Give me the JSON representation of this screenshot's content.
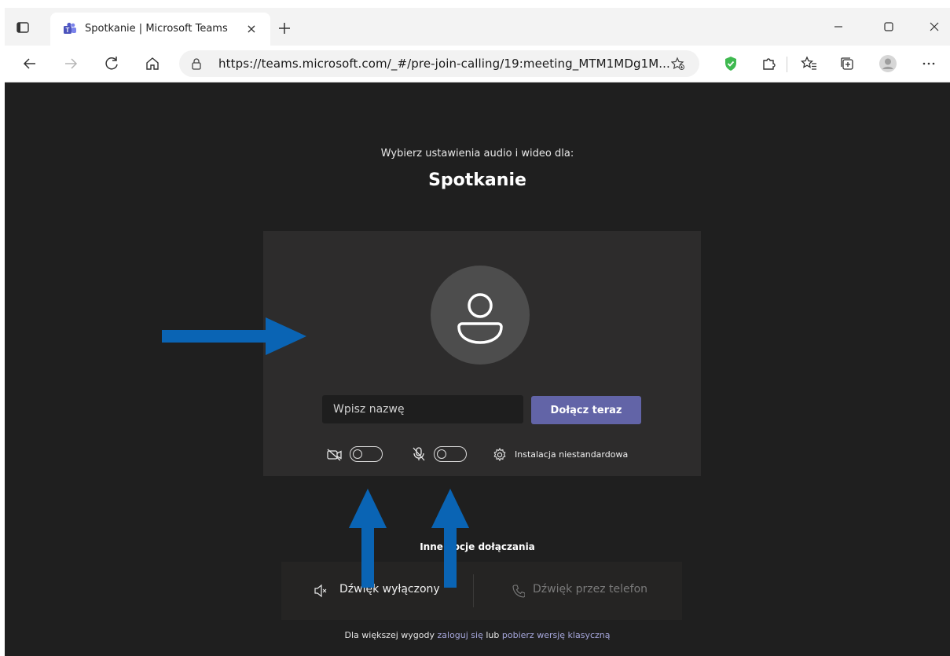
{
  "browser": {
    "tab_title": "Spotkanie | Microsoft Teams",
    "tab_close": "×",
    "url": "https://teams.microsoft.com/_#/pre-join-calling/19:meeting_MTM1MDg1M...",
    "window_controls": [
      "minimize-icon",
      "maximize-icon",
      "close-icon"
    ],
    "toolbar_icons": [
      "back-icon",
      "forward-icon",
      "refresh-icon",
      "home-icon",
      "lock-icon",
      "favorite-add-icon",
      "shield-extension-icon",
      "puzzle-extensions-icon",
      "favorites-icon",
      "collections-icon",
      "profile-icon",
      "more-icon"
    ]
  },
  "prejoin": {
    "subtitle": "Wybierz ustawienia audio i wideo dla:",
    "meeting_title": "Spotkanie",
    "name_placeholder": "Wpisz nazwę",
    "join_label": "Dołącz teraz",
    "custom_setup_label": "Instalacja niestandardowa",
    "other_options_label": "Inne opcje dołączania",
    "audio_off_label": "Dźwięk wyłączony",
    "audio_phone_label": "Dźwięk przez telefon",
    "footer": {
      "prefix": "Dla większej wygody ",
      "login_link": "zaloguj się",
      "middle": " lub ",
      "download_link": "pobierz wersję klasyczną"
    }
  },
  "colors": {
    "accent": "#6264a7",
    "content_bg": "#1f1f1f",
    "card_bg": "#2d2c2c",
    "annotation_arrow": "#0a64b4"
  },
  "toggles": {
    "camera_on": false,
    "mic_on": false
  }
}
